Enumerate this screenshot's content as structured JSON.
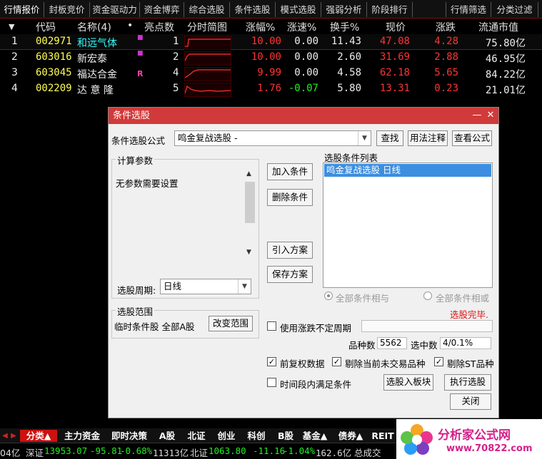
{
  "top_tabs": [
    "行情报价",
    "封板竞价",
    "资金驱动力",
    "资金博弈",
    "综合选股",
    "条件选股",
    "模式选股",
    "强弱分析",
    "阶段排行"
  ],
  "top_tabs_right": [
    "行情筛选",
    "分类过滤"
  ],
  "table_header": {
    "arrow": "▼",
    "code": "代码",
    "name": "名称(4)",
    "dot": "•",
    "highlights": "亮点数",
    "intraday": "分时简图",
    "change_pct": "涨幅%",
    "speed": "涨速%",
    "turnover": "换手%",
    "price": "现价",
    "change": "涨跌",
    "float_cap": "流通市值"
  },
  "rows": [
    {
      "idx": "1",
      "code": "002971",
      "name": "和远气体",
      "mark": "",
      "highlights": "1",
      "change_pct": "10.00",
      "speed": "0.00",
      "turnover": "11.43",
      "price": "47.08",
      "change": "4.28",
      "float_cap": "75.80亿"
    },
    {
      "idx": "2",
      "code": "603016",
      "name": "新宏泰",
      "mark": "",
      "highlights": "2",
      "change_pct": "10.00",
      "speed": "0.00",
      "turnover": "2.60",
      "price": "31.69",
      "change": "2.88",
      "float_cap": "46.95亿"
    },
    {
      "idx": "3",
      "code": "603045",
      "name": "福达合金",
      "mark": "R",
      "highlights": "4",
      "change_pct": "9.99",
      "speed": "0.00",
      "turnover": "4.58",
      "price": "62.18",
      "change": "5.65",
      "float_cap": "84.22亿"
    },
    {
      "idx": "4",
      "code": "002209",
      "name": "达 意 隆",
      "mark": "",
      "highlights": "5",
      "change_pct": "1.76",
      "speed": "-0.07",
      "turnover": "5.80",
      "price": "13.31",
      "change": "0.23",
      "float_cap": "21.01亿"
    }
  ],
  "dialog": {
    "title": "条件选股",
    "min_btn": "—",
    "close_btn": "✕",
    "formula_label": "条件选股公式",
    "formula_value": "鸣金复战选股  -",
    "btn_find": "查找",
    "btn_usage": "用法注释",
    "btn_view": "查看公式",
    "params_group": "计算参数",
    "params_text": "无参数需要设置",
    "period_label": "选股周期:",
    "period_value": "日线",
    "btn_add": "加入条件",
    "btn_delete": "删除条件",
    "btn_import": "引入方案",
    "btn_save": "保存方案",
    "list_label": "选股条件列表",
    "list_items": [
      "鸣金复战选股  日线"
    ],
    "radio_and": "全部条件相与",
    "radio_or": "全部条件相或",
    "status_done": "选股完毕.",
    "range_group": "选股范围",
    "range_text": "临时条件股 全部A股",
    "btn_change_range": "改变范围",
    "cb_period_label": "使用涨跌不定周期",
    "count_label": "品种数",
    "count_value": "5562",
    "selected_label": "选中数",
    "selected_value": "4/0.1%",
    "cb_adjusted": "前复权数据",
    "cb_exclude_untraded": "剔除当前未交易品种",
    "cb_exclude_st": "剔除ST品种",
    "cb_time_range": "时间段内满足条件",
    "btn_to_board": "选股入板块",
    "btn_execute": "执行选股",
    "btn_close": "关闭"
  },
  "bottom_tabs": [
    "分类▲",
    "主力资金",
    "即时决策",
    "A股",
    "北证",
    "创业",
    "科创",
    "B股",
    "基金▲",
    "债券▲",
    "REIT"
  ],
  "status": {
    "s1": "04亿",
    "s2_label": "深证",
    "s2_value": "13953.07",
    "s2_change": "-95.81",
    "s2_pct": "-0.68%",
    "s2_vol": "11313亿",
    "s3_label": "北证",
    "s3_value": "1063.80",
    "s3_change": "-11.16",
    "s3_pct": "-1.04%",
    "s3_vol": "162.6亿",
    "s4": "总成交"
  },
  "logo": {
    "line1": "分析家公式网",
    "line2": "www.70822.com"
  },
  "colors": {
    "accent": "#d13a3a",
    "up": "#ff3333",
    "down": "#22ee22",
    "code": "#ffff55"
  }
}
